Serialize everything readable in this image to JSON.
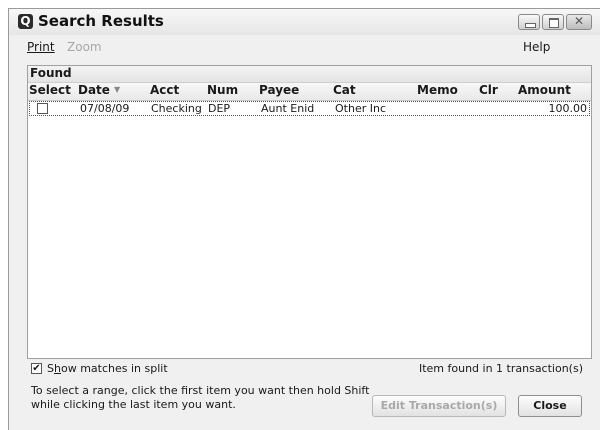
{
  "window": {
    "app_icon_letter": "Q",
    "title": "Search Results"
  },
  "menu": {
    "print": "Print",
    "zoom": "Zoom",
    "help": "Help"
  },
  "results": {
    "found_label": "Found",
    "columns": [
      "Select",
      "Date",
      "Acct",
      "Num",
      "Payee",
      "Cat",
      "Memo",
      "Clr",
      "Amount"
    ],
    "sort_arrow": "▼",
    "rows": [
      {
        "selected": false,
        "date": "07/08/09",
        "acct": "Checking",
        "num": "DEP",
        "payee": "Aunt Enid",
        "cat": "Other Inc",
        "memo": "",
        "clr": "",
        "amount": "100.00"
      }
    ]
  },
  "footer": {
    "show_matches_checked": true,
    "show_matches_label_pre": "S",
    "show_matches_label_ul": "h",
    "show_matches_label_post": "ow matches in split",
    "status": "Item found in 1 transaction(s)",
    "hint_line1": "To select a range, click the first item you want then hold Shift",
    "hint_line2": "while clicking the last item you want.",
    "edit_button": "Edit Transaction(s)",
    "close_button": "Close"
  }
}
